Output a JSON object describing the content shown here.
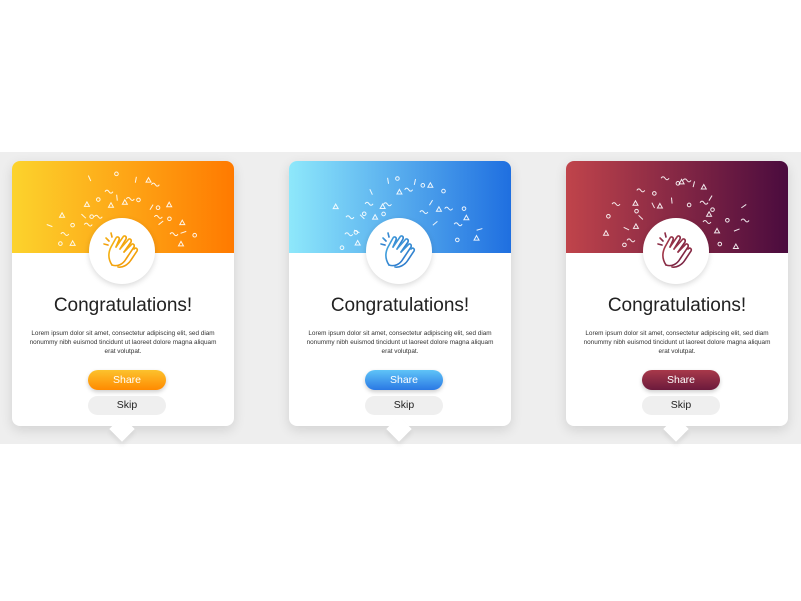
{
  "cards": [
    {
      "title": "Congratulations!",
      "body": "Lorem ipsum dolor sit amet, consectetur adipiscing elit, sed diam nonummy nibh euismod tincidunt ut laoreet dolore magna aliquam erat volutpat.",
      "share_label": "Share",
      "skip_label": "Skip",
      "icon": "clapping-hands-icon",
      "gradient": [
        "#fcd32d",
        "#ff7a00"
      ],
      "share_gradient": [
        "#fcc22d",
        "#ff8a00"
      ],
      "icon_colors": [
        "#f6c21b",
        "#f08a00"
      ]
    },
    {
      "title": "Congratulations!",
      "body": "Lorem ipsum dolor sit amet, consectetur adipiscing elit, sed diam nonummy nibh euismod tincidunt ut laoreet dolore magna aliquam erat volutpat.",
      "share_label": "Share",
      "skip_label": "Skip",
      "icon": "clapping-hands-icon",
      "gradient": [
        "#8ee8fb",
        "#1f6fe0"
      ],
      "share_gradient": [
        "#5fc4f8",
        "#2a78e4"
      ],
      "icon_colors": [
        "#4fb9e8",
        "#1f5fbf"
      ]
    },
    {
      "title": "Congratulations!",
      "body": "Lorem ipsum dolor sit amet, consectetur adipiscing elit, sed diam nonummy nibh euismod tincidunt ut laoreet dolore magna aliquam erat volutpat.",
      "share_label": "Share",
      "skip_label": "Skip",
      "icon": "clapping-hands-icon",
      "gradient": [
        "#c0444b",
        "#4a0b3e"
      ],
      "share_gradient": [
        "#a8394a",
        "#6b1a3c"
      ],
      "icon_colors": [
        "#c0444b",
        "#5a1640"
      ]
    }
  ]
}
